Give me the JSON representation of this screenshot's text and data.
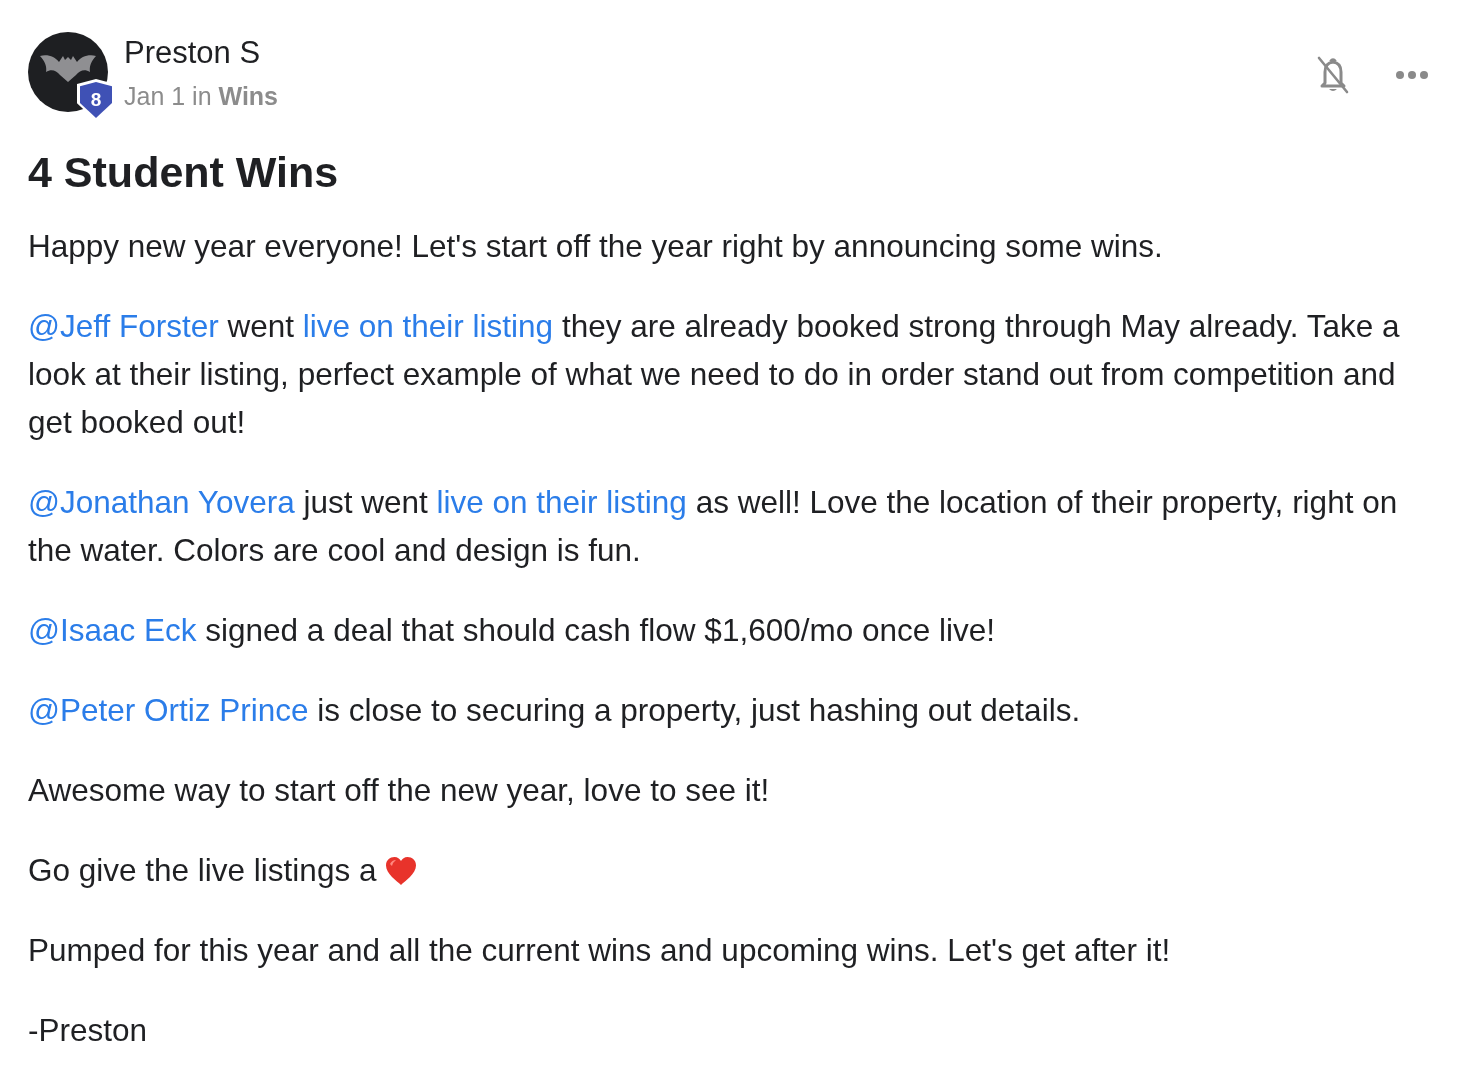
{
  "post": {
    "author": {
      "name": "Preston S",
      "badge": "8"
    },
    "meta": "Jan 1 in **Wins**",
    "notifications_muted": true,
    "title": "4 Student Wins",
    "paragraphs": [
      {
        "segments": [
          {
            "kind": "text",
            "text": "Happy new year everyone! Let's start off the year right by announcing some wins."
          }
        ]
      },
      {
        "segments": [
          {
            "kind": "mention",
            "text": "@Jeff Forster"
          },
          {
            "kind": "text",
            "text": " went "
          },
          {
            "kind": "link",
            "text": "live on their listing"
          },
          {
            "kind": "text",
            "text": " they are already booked strong through May already. Take a look at their listing, perfect example of what we need to do in order stand out from competition and get booked out!"
          }
        ]
      },
      {
        "segments": [
          {
            "kind": "mention",
            "text": "@Jonathan Yovera"
          },
          {
            "kind": "text",
            "text": " just went "
          },
          {
            "kind": "link",
            "text": "live on their listing"
          },
          {
            "kind": "text",
            "text": " as well! Love the location of their property, right on the water. Colors are cool and design is fun."
          }
        ]
      },
      {
        "segments": [
          {
            "kind": "mention",
            "text": "@Isaac Eck"
          },
          {
            "kind": "text",
            "text": " signed a deal that should cash flow $1,600/mo once live!"
          }
        ]
      },
      {
        "segments": [
          {
            "kind": "mention",
            "text": "@Peter Ortiz Prince"
          },
          {
            "kind": "text",
            "text": " is close to securing a property, just hashing out details."
          }
        ]
      },
      {
        "segments": [
          {
            "kind": "text",
            "text": "Awesome way to start off the new year, love to see it!"
          }
        ]
      },
      {
        "segments": [
          {
            "kind": "text",
            "text": "Go give the live listings a "
          },
          {
            "kind": "heart"
          }
        ]
      },
      {
        "segments": [
          {
            "kind": "text",
            "text": "Pumped for this year and all the current wins and upcoming wins. Let's get after it!"
          }
        ]
      },
      {
        "segments": [
          {
            "kind": "text",
            "text": "-Preston"
          }
        ]
      }
    ]
  }
}
